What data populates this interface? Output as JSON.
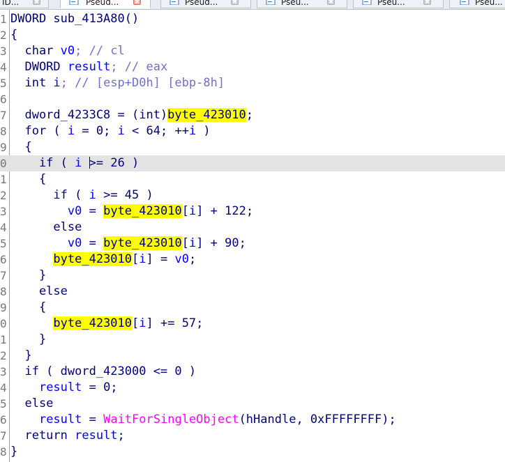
{
  "tabs": [
    {
      "label": "ID...",
      "icon": "ida-view-icon",
      "active": false
    },
    {
      "label": "Pseud...",
      "icon": "pseudocode-icon",
      "active": true
    },
    {
      "label": "Pseud...",
      "icon": "pseudocode-icon",
      "active": false
    },
    {
      "label": "Pseu...",
      "icon": "pseudocode-icon",
      "active": false
    },
    {
      "label": "Pseu...",
      "icon": "pseudocode-icon",
      "active": false
    },
    {
      "label": "Pseu...",
      "icon": "pseudocode-icon",
      "active": false
    }
  ],
  "colors": {
    "keyword": "#000080",
    "local_var": "#0000ff",
    "comment": "#6f6fd0",
    "highlight": "#ffff00",
    "import_func": "#ff00ff",
    "current_line": "#e3e3e3"
  },
  "code": {
    "current_line_index": 9,
    "lines": [
      {
        "num": "1",
        "tokens": [
          {
            "t": "DWORD sub_413A80()",
            "c": "kw"
          }
        ]
      },
      {
        "num": "2",
        "tokens": [
          {
            "t": "{",
            "c": "kw"
          }
        ]
      },
      {
        "num": "3",
        "tokens": [
          {
            "t": "  char ",
            "c": "kw"
          },
          {
            "t": "v0",
            "c": "var"
          },
          {
            "t": "; // cl",
            "c": "cmt"
          }
        ]
      },
      {
        "num": "4",
        "tokens": [
          {
            "t": "  DWORD ",
            "c": "kw"
          },
          {
            "t": "result",
            "c": "var"
          },
          {
            "t": "; // eax",
            "c": "cmt"
          }
        ]
      },
      {
        "num": "5",
        "tokens": [
          {
            "t": "  int ",
            "c": "kw"
          },
          {
            "t": "i",
            "c": "var"
          },
          {
            "t": "; // [esp+D0h] [ebp-8h]",
            "c": "cmt"
          }
        ]
      },
      {
        "num": "6",
        "tokens": []
      },
      {
        "num": "7",
        "tokens": [
          {
            "t": "  dword_4233C8 = (int)",
            "c": "glob"
          },
          {
            "t": "byte_423010",
            "c": "hl"
          },
          {
            "t": ";",
            "c": "kw"
          }
        ]
      },
      {
        "num": "8",
        "tokens": [
          {
            "t": "  for ( ",
            "c": "kw"
          },
          {
            "t": "i",
            "c": "var"
          },
          {
            "t": " = 0; ",
            "c": "kw"
          },
          {
            "t": "i",
            "c": "var"
          },
          {
            "t": " < 64; ++",
            "c": "kw"
          },
          {
            "t": "i",
            "c": "var"
          },
          {
            "t": " )",
            "c": "kw"
          }
        ]
      },
      {
        "num": "9",
        "tokens": [
          {
            "t": "  {",
            "c": "kw"
          }
        ]
      },
      {
        "num": "0",
        "tokens": [
          {
            "t": "    if ( ",
            "c": "kw"
          },
          {
            "t": "i",
            "c": "var"
          },
          {
            "t": " ",
            "c": "kw"
          },
          {
            "t": "|",
            "c": "caret"
          },
          {
            "t": ">= 26 )",
            "c": "kw"
          }
        ]
      },
      {
        "num": "1",
        "tokens": [
          {
            "t": "    {",
            "c": "kw"
          }
        ]
      },
      {
        "num": "2",
        "tokens": [
          {
            "t": "      if ( ",
            "c": "kw"
          },
          {
            "t": "i",
            "c": "var"
          },
          {
            "t": " >= 45 )",
            "c": "kw"
          }
        ]
      },
      {
        "num": "3",
        "tokens": [
          {
            "t": "        ",
            "c": "kw"
          },
          {
            "t": "v0",
            "c": "var"
          },
          {
            "t": " = ",
            "c": "kw"
          },
          {
            "t": "byte_423010",
            "c": "hl"
          },
          {
            "t": "[",
            "c": "kw"
          },
          {
            "t": "i",
            "c": "var"
          },
          {
            "t": "] + 122;",
            "c": "kw"
          }
        ]
      },
      {
        "num": "4",
        "tokens": [
          {
            "t": "      else",
            "c": "kw"
          }
        ]
      },
      {
        "num": "5",
        "tokens": [
          {
            "t": "        ",
            "c": "kw"
          },
          {
            "t": "v0",
            "c": "var"
          },
          {
            "t": " = ",
            "c": "kw"
          },
          {
            "t": "byte_423010",
            "c": "hl"
          },
          {
            "t": "[",
            "c": "kw"
          },
          {
            "t": "i",
            "c": "var"
          },
          {
            "t": "] + 90;",
            "c": "kw"
          }
        ]
      },
      {
        "num": "6",
        "tokens": [
          {
            "t": "      ",
            "c": "kw"
          },
          {
            "t": "byte_423010",
            "c": "hl"
          },
          {
            "t": "[",
            "c": "kw"
          },
          {
            "t": "i",
            "c": "var"
          },
          {
            "t": "] = ",
            "c": "kw"
          },
          {
            "t": "v0",
            "c": "var"
          },
          {
            "t": ";",
            "c": "kw"
          }
        ]
      },
      {
        "num": "7",
        "tokens": [
          {
            "t": "    }",
            "c": "kw"
          }
        ]
      },
      {
        "num": "8",
        "tokens": [
          {
            "t": "    else",
            "c": "kw"
          }
        ]
      },
      {
        "num": "9",
        "tokens": [
          {
            "t": "    {",
            "c": "kw"
          }
        ]
      },
      {
        "num": "0",
        "tokens": [
          {
            "t": "      ",
            "c": "kw"
          },
          {
            "t": "byte_423010",
            "c": "hl"
          },
          {
            "t": "[",
            "c": "kw"
          },
          {
            "t": "i",
            "c": "var"
          },
          {
            "t": "] += 57;",
            "c": "kw"
          }
        ]
      },
      {
        "num": "1",
        "tokens": [
          {
            "t": "    }",
            "c": "kw"
          }
        ]
      },
      {
        "num": "2",
        "tokens": [
          {
            "t": "  }",
            "c": "kw"
          }
        ]
      },
      {
        "num": "3",
        "tokens": [
          {
            "t": "  if ( dword_423000 <= 0 )",
            "c": "kw"
          }
        ]
      },
      {
        "num": "4",
        "tokens": [
          {
            "t": "    ",
            "c": "kw"
          },
          {
            "t": "result",
            "c": "var"
          },
          {
            "t": " = 0;",
            "c": "kw"
          }
        ]
      },
      {
        "num": "5",
        "tokens": [
          {
            "t": "  else",
            "c": "kw"
          }
        ]
      },
      {
        "num": "6",
        "tokens": [
          {
            "t": "    ",
            "c": "kw"
          },
          {
            "t": "result",
            "c": "var"
          },
          {
            "t": " = ",
            "c": "kw"
          },
          {
            "t": "WaitForSingleObject",
            "c": "func"
          },
          {
            "t": "(hHandle, 0xFFFFFFFF);",
            "c": "kw"
          }
        ]
      },
      {
        "num": "7",
        "tokens": [
          {
            "t": "  return ",
            "c": "kw"
          },
          {
            "t": "result",
            "c": "var"
          },
          {
            "t": ";",
            "c": "kw"
          }
        ]
      },
      {
        "num": "8",
        "tokens": [
          {
            "t": "}",
            "c": "kw"
          }
        ]
      }
    ]
  }
}
